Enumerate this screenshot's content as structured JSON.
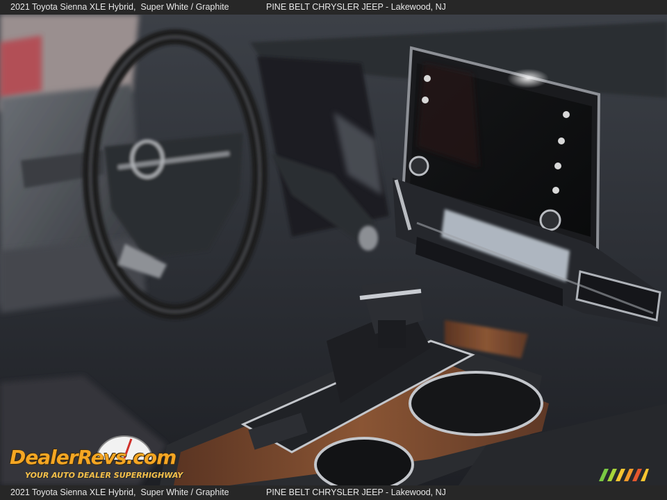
{
  "caption": {
    "vehicle": "2021 Toyota Sienna XLE Hybrid,  Super White / Graphite",
    "dealer": "PINE BELT CHRYSLER JEEP - Lakewood, NJ"
  },
  "watermark": {
    "brand": "DealerRevs.com",
    "tagline": "YOUR AUTO DEALER SUPERHIGHWAY"
  },
  "scene": {
    "subject": "interior dashboard, steering wheel, touchscreen, shifter, cupholders",
    "colors": {
      "dash": "#2a2d33",
      "wood": "#7a4a2e",
      "chrome": "#c9ccd2",
      "seat": "#3a3d44",
      "door": "#55595f"
    }
  }
}
